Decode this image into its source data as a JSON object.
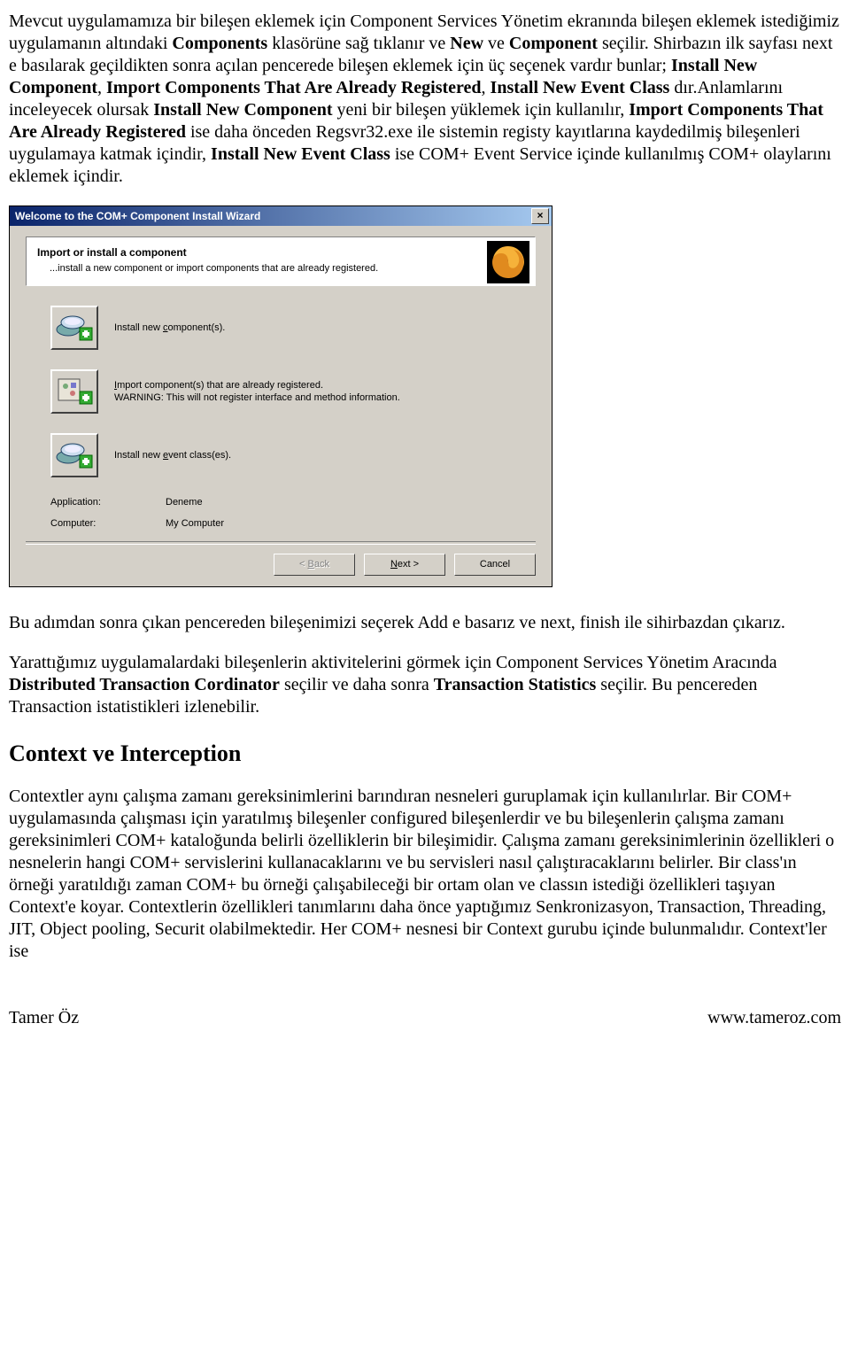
{
  "para1_pre": "Mevcut uygulamamıza bir bileşen eklemek için Component Services Yönetim ekranında bileşen eklemek istediğimiz uygulamanın altındaki ",
  "para1_bold1": "Components",
  "para1_mid1": " klasörüne sağ tıklanır ve ",
  "para1_bold2": "New",
  "para1_mid2": " ve ",
  "para1_bold3": "Component",
  "para1_mid3": " seçilir. Shirbazın ilk sayfası next e basılarak geçildikten sonra açılan pencerede bileşen eklemek için üç seçenek vardır bunlar; ",
  "para1_bold4": "Install New Component",
  "para1_mid4": ", ",
  "para1_bold5": "Import Components That Are Already Registered",
  "para1_mid5": ", ",
  "para1_bold6": "Install New Event Class",
  "para1_mid6": " dır.Anlamlarını inceleyecek olursak ",
  "para1_bold7": "Install New Component",
  "para1_mid7": " yeni bir bileşen yüklemek için kullanılır, ",
  "para1_bold8": "Import Components That Are Already Registered",
  "para1_mid8": " ise daha önceden Regsvr32.exe ile sistemin registy kayıtlarına kaydedilmiş bileşenleri uygulamaya katmak içindir, ",
  "para1_bold9": "Install New Event Class",
  "para1_end": " ise COM+ Event Service içinde kullanılmış COM+ olaylarını eklemek içindir.",
  "dialog": {
    "title": "Welcome to the COM+ Component Install Wizard",
    "header_title": "Import or install a component",
    "header_sub": "...install a new component or import components that are already registered.",
    "opt1_pre": "Install new ",
    "opt1_under": "c",
    "opt1_post": "omponent(s).",
    "opt2_line1_pre": "",
    "opt2_line1_under": "I",
    "opt2_line1_post": "mport component(s) that are already registered.",
    "opt2_line2": "WARNING: This will not register interface and method information.",
    "opt3_pre": "Install new ",
    "opt3_under": "e",
    "opt3_post": "vent class(es).",
    "app_label": "Application:",
    "app_value": "Deneme",
    "comp_label": "Computer:",
    "comp_value": "My Computer",
    "back_pre": "< ",
    "back_under": "B",
    "back_post": "ack",
    "next_under": "N",
    "next_post": "ext >",
    "cancel": "Cancel"
  },
  "para2": "Bu adımdan sonra çıkan pencereden bileşenimizi seçerek Add e basarız ve next, finish ile sihirbazdan çıkarız.",
  "para3_pre": "Yarattığımız uygulamalardaki bileşenlerin aktivitelerini görmek için Component Services Yönetim Aracında ",
  "para3_bold1": "Distributed Transaction Cordinator",
  "para3_mid1": " seçilir ve daha sonra ",
  "para3_bold2": "Transaction Statistics",
  "para3_end": " seçilir. Bu pencereden Transaction istatistikleri izlenebilir.",
  "heading": "Context ve Interception",
  "para4": "Contextler aynı çalışma zamanı gereksinimlerini barındıran nesneleri guruplamak için kullanılırlar. Bir COM+ uygulamasında çalışması için yaratılmış bileşenler  configured bileşenlerdir ve bu bileşenlerin çalışma zamanı gereksinimleri COM+ kataloğunda belirli özelliklerin bir bileşimidir. Çalışma zamanı gereksinimlerinin özellikleri o nesnelerin hangi COM+ servislerini kullanacaklarını ve bu servisleri nasıl çalıştıracaklarını belirler. Bir class'ın örneği yaratıldığı zaman COM+ bu örneği çalışabileceği bir ortam olan ve classın istediği özellikleri taşıyan Context'e koyar. Contextlerin özellikleri tanımlarını daha önce yaptığımız Senkronizasyon, Transaction, Threading, JIT, Object pooling, Securit olabilmektedir.  Her COM+ nesnesi bir Context gurubu içinde bulunmalıdır. Context'ler ise",
  "footer_left": "Tamer Öz",
  "footer_right": "www.tameroz.com"
}
